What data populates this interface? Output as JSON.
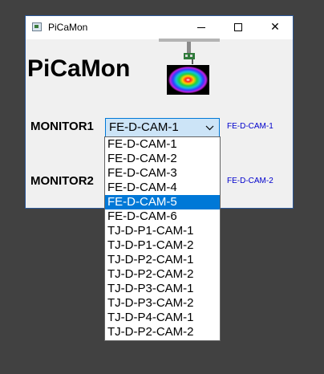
{
  "window": {
    "title": "PiCaMon",
    "controls": {
      "minimize": "minimize",
      "maximize": "maximize",
      "close": "✕"
    }
  },
  "app": {
    "heading": "PiCaMon"
  },
  "monitors": [
    {
      "label": "MONITOR1",
      "selected": "FE-D-CAM-1",
      "status": "FE-D-CAM-1"
    },
    {
      "label": "MONITOR2",
      "status": "FE-D-CAM-2"
    }
  ],
  "dropdown": {
    "highlighted": "FE-D-CAM-5",
    "options": [
      "FE-D-CAM-1",
      "FE-D-CAM-2",
      "FE-D-CAM-3",
      "FE-D-CAM-4",
      "FE-D-CAM-5",
      "FE-D-CAM-6",
      "TJ-D-P1-CAM-1",
      "TJ-D-P1-CAM-2",
      "TJ-D-P2-CAM-1",
      "TJ-D-P2-CAM-2",
      "TJ-D-P3-CAM-1",
      "TJ-D-P3-CAM-2",
      "TJ-D-P4-CAM-1",
      "TJ-D-P2-CAM-2"
    ]
  },
  "icons": {
    "app": "window-app-icon",
    "logo": "camera-target-logo",
    "dropdown": "chevron-down-icon"
  },
  "colors": {
    "accent": "#0078d7",
    "select_bg": "#cce4f7",
    "status_text": "#0000cc",
    "desktop": "#414141"
  }
}
